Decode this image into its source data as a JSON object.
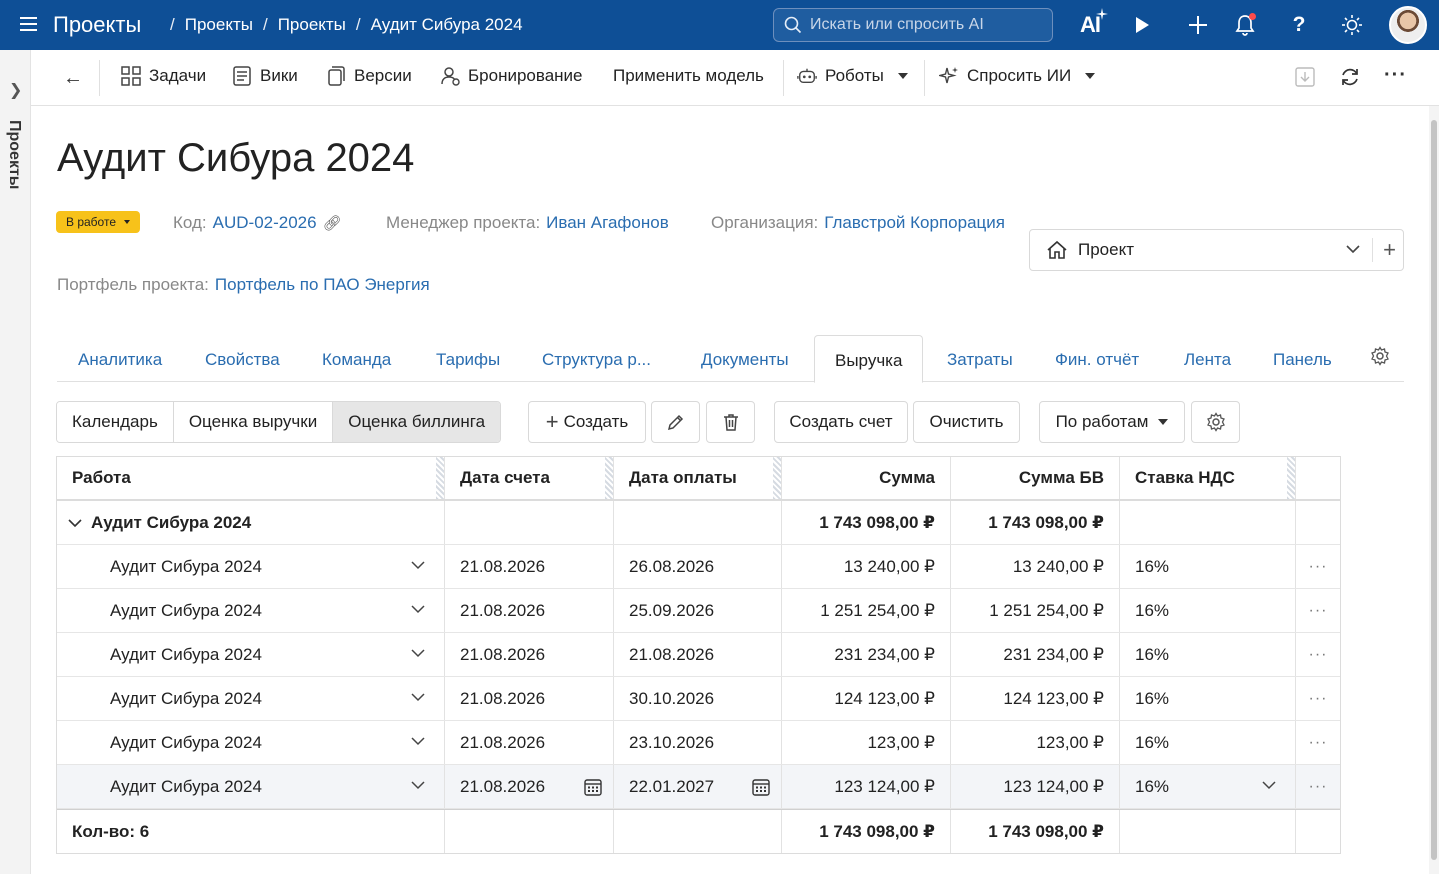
{
  "topbar": {
    "app_title": "Проекты",
    "breadcrumbs": [
      "Проекты",
      "Проекты",
      "Аудит Сибура 2024"
    ],
    "search_placeholder": "Искать или спросить AI",
    "ai_label": "AI"
  },
  "rail": {
    "label": "Проекты"
  },
  "toolbar": {
    "tasks": "Задачи",
    "wiki": "Вики",
    "versions": "Версии",
    "booking": "Бронирование",
    "apply_model": "Применить модель",
    "robots": "Роботы",
    "ask_ai": "Спросить ИИ"
  },
  "project": {
    "title": "Аудит Сибура 2024",
    "status": "В работе",
    "code_label": "Код:",
    "code": "AUD-02-2026",
    "manager_label": "Менеджер проекта:",
    "manager": "Иван Агафонов",
    "org_label": "Организация:",
    "org": "Главстрой Корпорация",
    "portfolio_label": "Портфель проекта:",
    "portfolio": "Портфель по ПАО Энергия",
    "type_select": "Проект"
  },
  "tabs": [
    "Аналитика",
    "Свойства",
    "Команда",
    "Тарифы",
    "Структура р...",
    "Документы",
    "Выручка",
    "Затраты",
    "Фин. отчёт",
    "Лента",
    "Панель"
  ],
  "active_tab": "Выручка",
  "actions": {
    "views": [
      "Календарь",
      "Оценка выручки",
      "Оценка биллинга"
    ],
    "active_view": "Оценка биллинга",
    "create": "Создать",
    "create_invoice": "Создать счет",
    "clear": "Очистить",
    "group_by": "По работам"
  },
  "grid": {
    "columns": [
      "Работа",
      "Дата счета",
      "Дата оплаты",
      "Сумма",
      "Сумма БВ",
      "Ставка НДС"
    ],
    "group": {
      "name": "Аудит Сибура 2024",
      "sum": "1 743 098,00 ₽",
      "sum_bv": "1 743 098,00 ₽"
    },
    "rows": [
      {
        "work": "Аудит Сибура 2024",
        "invoice_date": "21.08.2026",
        "pay_date": "26.08.2026",
        "sum": "13 240,00 ₽",
        "sum_bv": "13 240,00 ₽",
        "vat": "16%"
      },
      {
        "work": "Аудит Сибура 2024",
        "invoice_date": "21.08.2026",
        "pay_date": "25.09.2026",
        "sum": "1 251 254,00 ₽",
        "sum_bv": "1 251 254,00 ₽",
        "vat": "16%"
      },
      {
        "work": "Аудит Сибура 2024",
        "invoice_date": "21.08.2026",
        "pay_date": "21.08.2026",
        "sum": "231 234,00 ₽",
        "sum_bv": "231 234,00 ₽",
        "vat": "16%"
      },
      {
        "work": "Аудит Сибура 2024",
        "invoice_date": "21.08.2026",
        "pay_date": "30.10.2026",
        "sum": "124 123,00 ₽",
        "sum_bv": "124 123,00 ₽",
        "vat": "16%"
      },
      {
        "work": "Аудит Сибура 2024",
        "invoice_date": "21.08.2026",
        "pay_date": "23.10.2026",
        "sum": "123,00 ₽",
        "sum_bv": "123,00 ₽",
        "vat": "16%"
      },
      {
        "work": "Аудит Сибура 2024",
        "invoice_date": "21.08.2026",
        "pay_date": "22.01.2027",
        "sum": "123 124,00 ₽",
        "sum_bv": "123 124,00 ₽",
        "vat": "16%"
      }
    ],
    "total": {
      "label": "Кол-во: 6",
      "sum": "1 743 098,00 ₽",
      "sum_bv": "1 743 098,00 ₽"
    }
  },
  "colors": {
    "topbar": "#0e4f96",
    "link": "#2a6db0",
    "status": "#f7c21a"
  }
}
